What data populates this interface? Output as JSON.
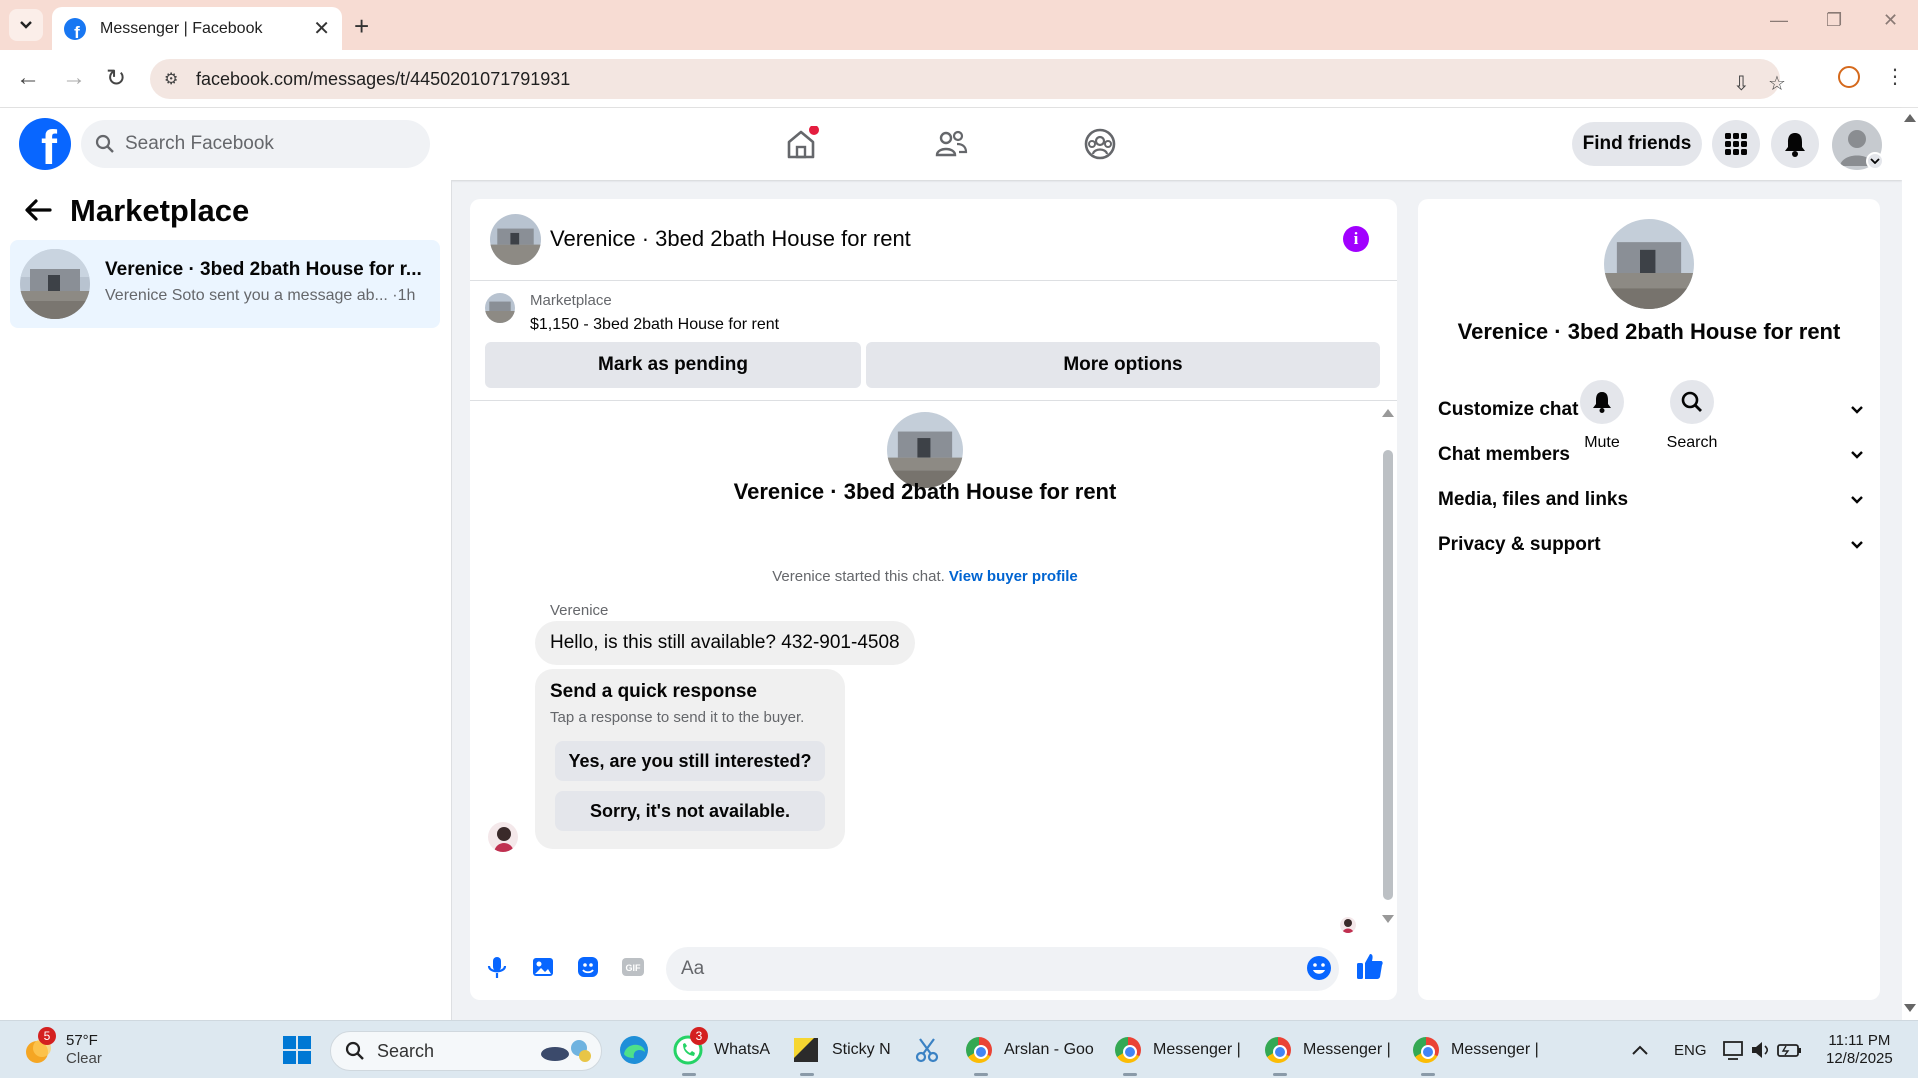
{
  "browser": {
    "tab_title": "Messenger | Facebook",
    "url": "facebook.com/messages/t/4450201071791931"
  },
  "fb_header": {
    "search_placeholder": "Search Facebook",
    "find_friends": "Find friends"
  },
  "left": {
    "title": "Marketplace",
    "conversations": [
      {
        "title": "Verenice · 3bed 2bath House for r...",
        "preview": "Verenice Soto sent you a message ab...",
        "time": "·1h"
      }
    ]
  },
  "chat": {
    "title": "Verenice · 3bed 2bath House for rent",
    "listing_label": "Marketplace",
    "listing_price": "$1,150 - 3bed 2bath House for rent",
    "mark_pending": "Mark as pending",
    "more_options": "More options",
    "intro_title": "Verenice · 3bed 2bath House for rent",
    "started_text": "Verenice started this chat.",
    "view_buyer": "View buyer profile",
    "sender_name": "Verenice",
    "message": "Hello, is this still available? 432-901-4508",
    "quick_title": "Send a quick response",
    "quick_sub": "Tap a response to send it to the buyer.",
    "quick_1": "Yes, are you still interested?",
    "quick_2": "Sorry, it's not available.",
    "composer_placeholder": "Aa"
  },
  "info": {
    "title": "Verenice · 3bed 2bath House for rent",
    "mute": "Mute",
    "search": "Search",
    "sections": [
      "Customize chat",
      "Chat members",
      "Media, files and links",
      "Privacy & support"
    ]
  },
  "taskbar": {
    "weather_badge": "5",
    "temp": "57°F",
    "cond": "Clear",
    "search": "Search",
    "whatsapp_badge": "3",
    "whatsapp": "WhatsA",
    "sticky": "Sticky N",
    "chrome1": "Arslan - Goo",
    "chrome2": "Messenger |",
    "chrome3": "Messenger |",
    "chrome4": "Messenger |",
    "lang": "ENG",
    "time": "11:11 PM",
    "date": "12/8/2025"
  },
  "colors": {
    "fb_blue": "#0866ff",
    "link_blue": "#0064d1",
    "messenger_purple": "#a100ff",
    "notification_red": "#e41e3f"
  }
}
